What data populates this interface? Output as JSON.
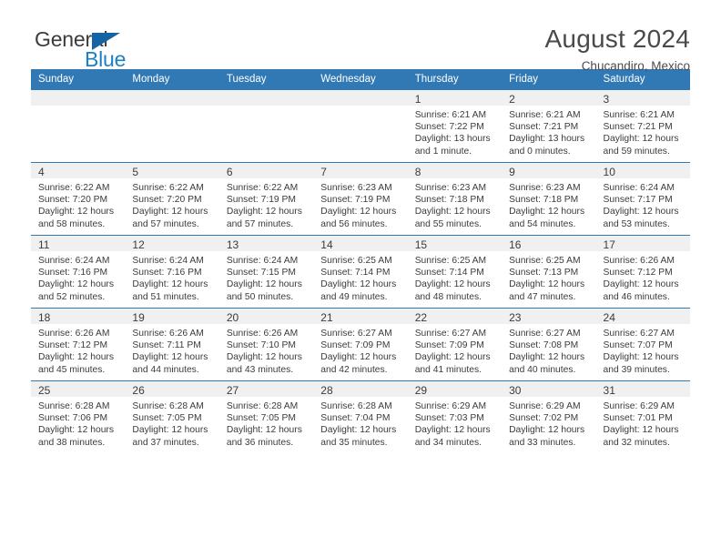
{
  "brand": {
    "name_top": "General",
    "name_bottom": "Blue",
    "accent_color": "#1464a5",
    "blue_text_color": "#1b7fc4"
  },
  "header": {
    "title": "August 2024",
    "subtitle": "Chucandiro, Mexico"
  },
  "theme": {
    "header_band": "#3179b5",
    "daynum_band": "#f0f0f0",
    "text": "#3b3b3b"
  },
  "weekdays": [
    "Sunday",
    "Monday",
    "Tuesday",
    "Wednesday",
    "Thursday",
    "Friday",
    "Saturday"
  ],
  "weeks": [
    [
      {
        "day": "",
        "lines": []
      },
      {
        "day": "",
        "lines": []
      },
      {
        "day": "",
        "lines": []
      },
      {
        "day": "",
        "lines": []
      },
      {
        "day": "1",
        "lines": [
          "Sunrise: 6:21 AM",
          "Sunset: 7:22 PM",
          "Daylight: 13 hours",
          "and 1 minute."
        ]
      },
      {
        "day": "2",
        "lines": [
          "Sunrise: 6:21 AM",
          "Sunset: 7:21 PM",
          "Daylight: 13 hours",
          "and 0 minutes."
        ]
      },
      {
        "day": "3",
        "lines": [
          "Sunrise: 6:21 AM",
          "Sunset: 7:21 PM",
          "Daylight: 12 hours",
          "and 59 minutes."
        ]
      }
    ],
    [
      {
        "day": "4",
        "lines": [
          "Sunrise: 6:22 AM",
          "Sunset: 7:20 PM",
          "Daylight: 12 hours",
          "and 58 minutes."
        ]
      },
      {
        "day": "5",
        "lines": [
          "Sunrise: 6:22 AM",
          "Sunset: 7:20 PM",
          "Daylight: 12 hours",
          "and 57 minutes."
        ]
      },
      {
        "day": "6",
        "lines": [
          "Sunrise: 6:22 AM",
          "Sunset: 7:19 PM",
          "Daylight: 12 hours",
          "and 57 minutes."
        ]
      },
      {
        "day": "7",
        "lines": [
          "Sunrise: 6:23 AM",
          "Sunset: 7:19 PM",
          "Daylight: 12 hours",
          "and 56 minutes."
        ]
      },
      {
        "day": "8",
        "lines": [
          "Sunrise: 6:23 AM",
          "Sunset: 7:18 PM",
          "Daylight: 12 hours",
          "and 55 minutes."
        ]
      },
      {
        "day": "9",
        "lines": [
          "Sunrise: 6:23 AM",
          "Sunset: 7:18 PM",
          "Daylight: 12 hours",
          "and 54 minutes."
        ]
      },
      {
        "day": "10",
        "lines": [
          "Sunrise: 6:24 AM",
          "Sunset: 7:17 PM",
          "Daylight: 12 hours",
          "and 53 minutes."
        ]
      }
    ],
    [
      {
        "day": "11",
        "lines": [
          "Sunrise: 6:24 AM",
          "Sunset: 7:16 PM",
          "Daylight: 12 hours",
          "and 52 minutes."
        ]
      },
      {
        "day": "12",
        "lines": [
          "Sunrise: 6:24 AM",
          "Sunset: 7:16 PM",
          "Daylight: 12 hours",
          "and 51 minutes."
        ]
      },
      {
        "day": "13",
        "lines": [
          "Sunrise: 6:24 AM",
          "Sunset: 7:15 PM",
          "Daylight: 12 hours",
          "and 50 minutes."
        ]
      },
      {
        "day": "14",
        "lines": [
          "Sunrise: 6:25 AM",
          "Sunset: 7:14 PM",
          "Daylight: 12 hours",
          "and 49 minutes."
        ]
      },
      {
        "day": "15",
        "lines": [
          "Sunrise: 6:25 AM",
          "Sunset: 7:14 PM",
          "Daylight: 12 hours",
          "and 48 minutes."
        ]
      },
      {
        "day": "16",
        "lines": [
          "Sunrise: 6:25 AM",
          "Sunset: 7:13 PM",
          "Daylight: 12 hours",
          "and 47 minutes."
        ]
      },
      {
        "day": "17",
        "lines": [
          "Sunrise: 6:26 AM",
          "Sunset: 7:12 PM",
          "Daylight: 12 hours",
          "and 46 minutes."
        ]
      }
    ],
    [
      {
        "day": "18",
        "lines": [
          "Sunrise: 6:26 AM",
          "Sunset: 7:12 PM",
          "Daylight: 12 hours",
          "and 45 minutes."
        ]
      },
      {
        "day": "19",
        "lines": [
          "Sunrise: 6:26 AM",
          "Sunset: 7:11 PM",
          "Daylight: 12 hours",
          "and 44 minutes."
        ]
      },
      {
        "day": "20",
        "lines": [
          "Sunrise: 6:26 AM",
          "Sunset: 7:10 PM",
          "Daylight: 12 hours",
          "and 43 minutes."
        ]
      },
      {
        "day": "21",
        "lines": [
          "Sunrise: 6:27 AM",
          "Sunset: 7:09 PM",
          "Daylight: 12 hours",
          "and 42 minutes."
        ]
      },
      {
        "day": "22",
        "lines": [
          "Sunrise: 6:27 AM",
          "Sunset: 7:09 PM",
          "Daylight: 12 hours",
          "and 41 minutes."
        ]
      },
      {
        "day": "23",
        "lines": [
          "Sunrise: 6:27 AM",
          "Sunset: 7:08 PM",
          "Daylight: 12 hours",
          "and 40 minutes."
        ]
      },
      {
        "day": "24",
        "lines": [
          "Sunrise: 6:27 AM",
          "Sunset: 7:07 PM",
          "Daylight: 12 hours",
          "and 39 minutes."
        ]
      }
    ],
    [
      {
        "day": "25",
        "lines": [
          "Sunrise: 6:28 AM",
          "Sunset: 7:06 PM",
          "Daylight: 12 hours",
          "and 38 minutes."
        ]
      },
      {
        "day": "26",
        "lines": [
          "Sunrise: 6:28 AM",
          "Sunset: 7:05 PM",
          "Daylight: 12 hours",
          "and 37 minutes."
        ]
      },
      {
        "day": "27",
        "lines": [
          "Sunrise: 6:28 AM",
          "Sunset: 7:05 PM",
          "Daylight: 12 hours",
          "and 36 minutes."
        ]
      },
      {
        "day": "28",
        "lines": [
          "Sunrise: 6:28 AM",
          "Sunset: 7:04 PM",
          "Daylight: 12 hours",
          "and 35 minutes."
        ]
      },
      {
        "day": "29",
        "lines": [
          "Sunrise: 6:29 AM",
          "Sunset: 7:03 PM",
          "Daylight: 12 hours",
          "and 34 minutes."
        ]
      },
      {
        "day": "30",
        "lines": [
          "Sunrise: 6:29 AM",
          "Sunset: 7:02 PM",
          "Daylight: 12 hours",
          "and 33 minutes."
        ]
      },
      {
        "day": "31",
        "lines": [
          "Sunrise: 6:29 AM",
          "Sunset: 7:01 PM",
          "Daylight: 12 hours",
          "and 32 minutes."
        ]
      }
    ]
  ]
}
